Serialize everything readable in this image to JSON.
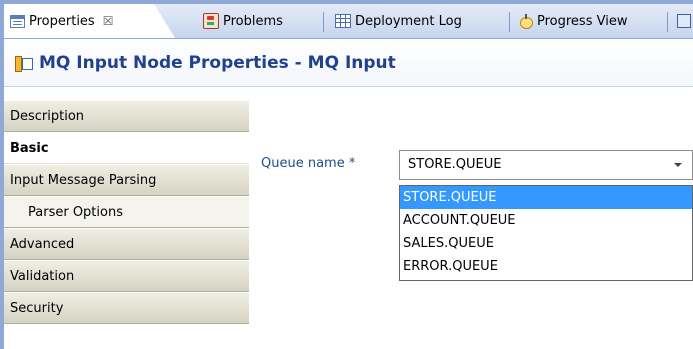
{
  "tabs": [
    {
      "label": "Properties",
      "icon": "properties-icon",
      "active": true,
      "close": "☒"
    },
    {
      "label": "Problems",
      "icon": "problems-icon"
    },
    {
      "label": "Deployment Log",
      "icon": "deployment-log-icon"
    },
    {
      "label": "Progress View",
      "icon": "progress-view-icon"
    },
    {
      "label": "",
      "icon": "console-icon"
    }
  ],
  "header": {
    "title": "MQ Input Node Properties - MQ Input",
    "icon": "node-properties-icon"
  },
  "sidebar": {
    "items": [
      {
        "label": "Description"
      },
      {
        "label": "Basic",
        "selected": true
      },
      {
        "label": "Input Message Parsing"
      },
      {
        "label": "Parser Options",
        "sub": true
      },
      {
        "label": "Advanced"
      },
      {
        "label": "Validation"
      },
      {
        "label": "Security"
      }
    ]
  },
  "form": {
    "queue_name_label": "Queue name *",
    "queue_name_value": "STORE.QUEUE",
    "dropdown_options": [
      "STORE.QUEUE",
      "ACCOUNT.QUEUE",
      "SALES.QUEUE",
      "ERROR.QUEUE"
    ],
    "highlighted_option": "STORE.QUEUE"
  },
  "colors": {
    "title": "#20418f",
    "label": "#1f4e8c",
    "selection": "#3399ff",
    "frame": "#8fa8d6"
  }
}
